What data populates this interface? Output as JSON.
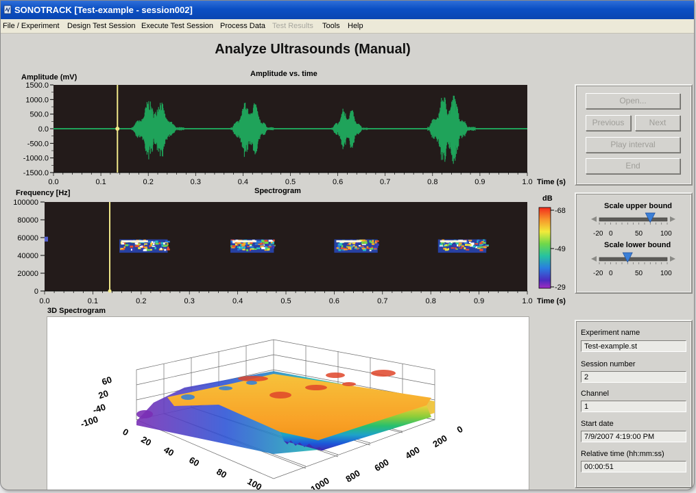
{
  "window": {
    "title": "SONOTRACK [Test-example - session002]"
  },
  "menu": [
    {
      "label": "File / Experiment",
      "enabled": true
    },
    {
      "label": "Design Test Session",
      "enabled": true
    },
    {
      "label": "Execute Test Session",
      "enabled": true
    },
    {
      "label": "Process Data",
      "enabled": true
    },
    {
      "label": "Test Results",
      "enabled": false
    },
    {
      "label": "Tools",
      "enabled": true
    },
    {
      "label": "Help",
      "enabled": true
    }
  ],
  "page_title": "Analyze Ultrasounds (Manual)",
  "amplitude_plot": {
    "title": "Amplitude vs. time",
    "y_label": "Amplitude (mV)",
    "x_label": "Time (s)",
    "y_ticks": [
      "1500.0",
      "1000.0",
      "500.0",
      "0.0",
      "-500.0",
      "-1000.0",
      "-1500.0"
    ],
    "x_ticks": [
      "0.0",
      "0.1",
      "0.2",
      "0.3",
      "0.4",
      "0.5",
      "0.6",
      "0.7",
      "0.8",
      "0.9",
      "1.0"
    ],
    "cursor_time": 0.135
  },
  "spectrogram": {
    "title": "Spectrogram",
    "y_label": "Frequency [Hz]",
    "x_label": "Time (s)",
    "y_ticks": [
      "100000",
      "80000",
      "60000",
      "40000",
      "20000",
      "0"
    ],
    "x_ticks": [
      "0.0",
      "0.1",
      "0.2",
      "0.3",
      "0.4",
      "0.5",
      "0.6",
      "0.7",
      "0.8",
      "0.9",
      "1.0"
    ],
    "cursor_time": 0.135,
    "colorbar": {
      "unit": "dB",
      "ticks": [
        "-68",
        "-49",
        "-29"
      ]
    }
  },
  "spectrogram_3d": {
    "title": "3D Spectrogram",
    "z_ticks": [
      "60",
      "20",
      "-40",
      "-100"
    ],
    "freq_ticks": [
      "0",
      "20",
      "40",
      "60",
      "80",
      "100"
    ],
    "time_ticks": [
      "0",
      "200",
      "400",
      "600",
      "800",
      "1000"
    ]
  },
  "playback": {
    "open_label": "Open...",
    "previous_label": "Previous",
    "next_label": "Next",
    "play_label": "Play interval",
    "end_label": "End"
  },
  "scale": {
    "upper_label": "Scale upper bound",
    "lower_label": "Scale lower bound",
    "ticks": [
      "-20",
      "0",
      "50",
      "100"
    ],
    "upper_value": 70,
    "lower_value": 30
  },
  "info": {
    "experiment_name_label": "Experiment name",
    "experiment_name": "Test-example.st",
    "session_number_label": "Session number",
    "session_number": "2",
    "channel_label": "Channel",
    "channel": "1",
    "start_date_label": "Start date",
    "start_date": "7/9/2007  4:19:00 PM",
    "relative_time_label": "Relative time (hh:mm:ss)",
    "relative_time": "00:00:51"
  },
  "colors": {
    "waveform": "#1fa35a",
    "cursor": "#f2ea8a",
    "plot_bg": "#231b1a",
    "slider_pointer": "#3b7fd6"
  }
}
